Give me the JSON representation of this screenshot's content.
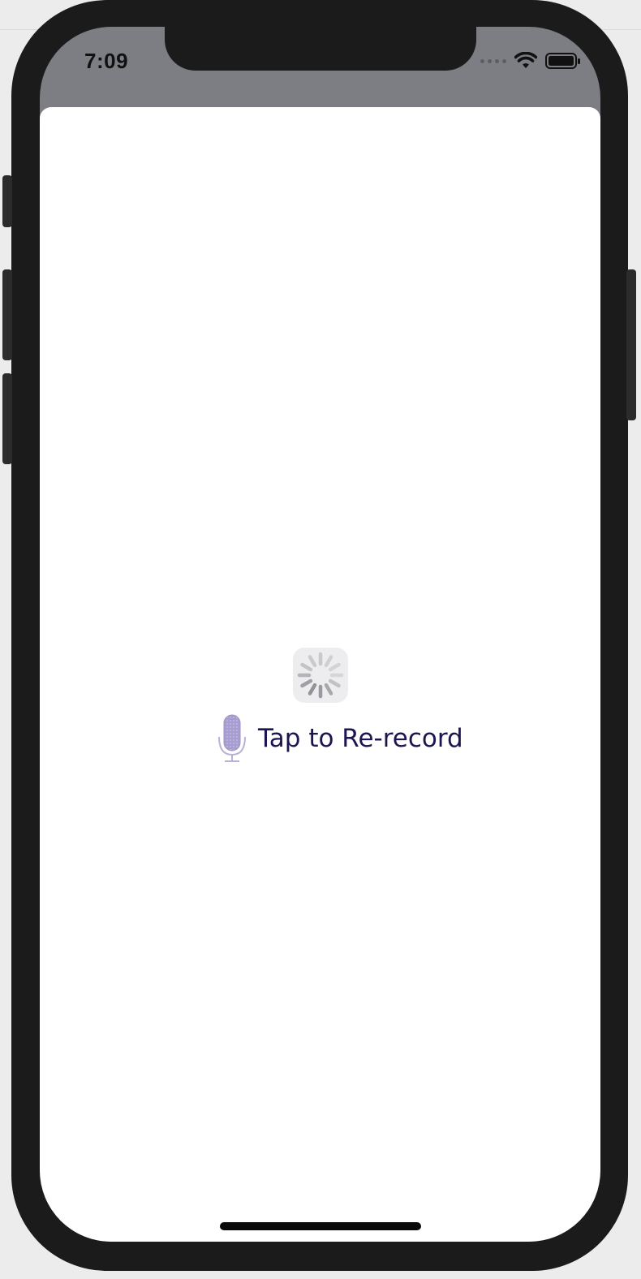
{
  "status_bar": {
    "time": "7:09",
    "signal_icon": "cellular-dots-icon",
    "wifi_icon": "wifi-icon",
    "battery_icon": "battery-icon"
  },
  "content": {
    "loading_icon": "activity-spinner-icon",
    "rerecord_icon": "microphone-icon",
    "rerecord_label": "Tap to Re-record"
  },
  "colors": {
    "status_bar_bg": "#7d7e83",
    "label_color": "#1c1650",
    "mic_color": "#a79dd0"
  }
}
